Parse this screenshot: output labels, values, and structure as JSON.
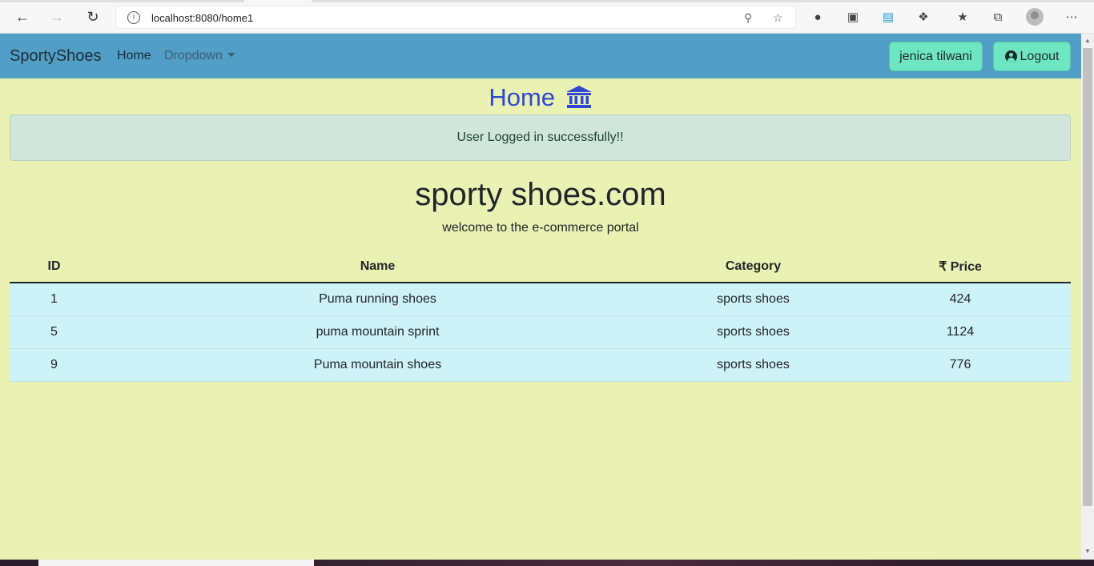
{
  "browser": {
    "url": "localhost:8080/home1"
  },
  "navbar": {
    "brand": "SportyShoes",
    "home": "Home",
    "dropdown": "Dropdown",
    "user_button": "jenica tilwani",
    "logout_button": "Logout"
  },
  "page": {
    "heading": "Home",
    "alert": "User Logged in successfully!!",
    "site_title": "sporty shoes.com",
    "site_subtitle": "welcome to the e-commerce portal"
  },
  "table": {
    "headers": [
      "ID",
      "Name",
      "Category",
      "₹ Price"
    ],
    "rows": [
      [
        "1",
        "Puma running shoes",
        "sports shoes",
        "424"
      ],
      [
        "5",
        "puma mountain sprint",
        "sports shoes",
        "1124"
      ],
      [
        "9",
        "Puma mountain shoes",
        "sports shoes",
        "776"
      ]
    ]
  },
  "colors": {
    "page_background": "#e9f1b3",
    "navbar": "#519ec6",
    "button": "#6ee6c2",
    "heading": "#2f48d1",
    "alert_bg": "#d0e6db",
    "row_bg": "#cdf2f8"
  }
}
